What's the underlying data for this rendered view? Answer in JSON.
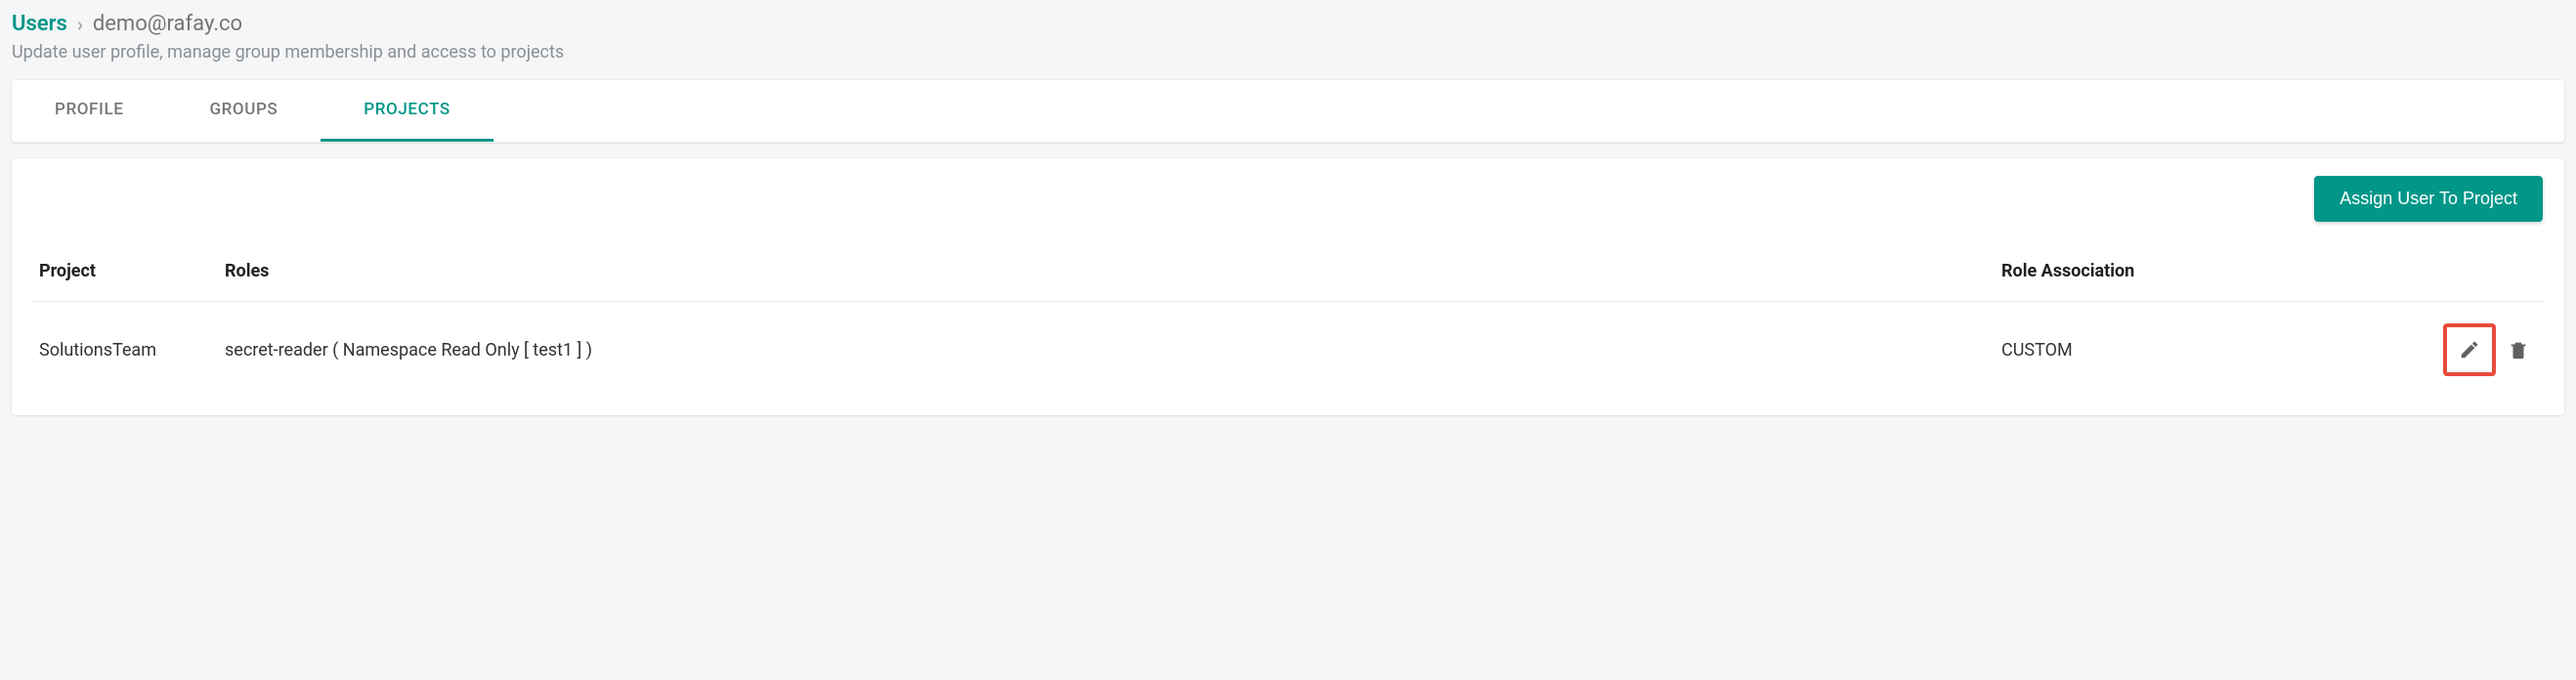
{
  "breadcrumb": {
    "root": "Users",
    "separator": "›",
    "current": "demo@rafay.co"
  },
  "subtitle": "Update user profile, manage group membership and access to projects",
  "tabs": [
    {
      "label": "PROFILE",
      "active": false
    },
    {
      "label": "GROUPS",
      "active": false
    },
    {
      "label": "PROJECTS",
      "active": true
    }
  ],
  "toolbar": {
    "assign_button": "Assign User To Project"
  },
  "table": {
    "headers": {
      "project": "Project",
      "roles": "Roles",
      "association": "Role Association"
    },
    "rows": [
      {
        "project": "SolutionsTeam",
        "roles": "secret-reader ( Namespace Read Only [ test1 ] )",
        "association": "CUSTOM"
      }
    ]
  }
}
